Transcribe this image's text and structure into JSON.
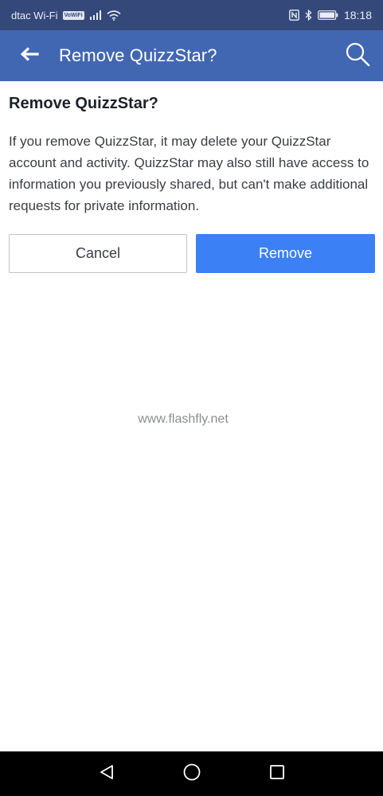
{
  "status_bar": {
    "carrier": "dtac Wi-Fi",
    "vowifi_badge": "VoWiFi",
    "time": "18:18"
  },
  "app_bar": {
    "title": "Remove QuizzStar?"
  },
  "dialog": {
    "title": "Remove QuizzStar?",
    "body": "If you remove QuizzStar, it may delete your QuizzStar account and activity. QuizzStar may also still have access to information you previously shared, but can't make additional requests for private information.",
    "cancel_label": "Cancel",
    "remove_label": "Remove"
  },
  "watermark": "www.flashfly.net",
  "colors": {
    "status_bar": "#34497a",
    "app_bar": "#4267b2",
    "primary_button": "#3b80f5"
  },
  "icons": {
    "back": "arrow-left-icon",
    "search": "search-icon",
    "nav_back": "triangle-back-icon",
    "nav_home": "circle-home-icon",
    "nav_recents": "square-recents-icon"
  }
}
